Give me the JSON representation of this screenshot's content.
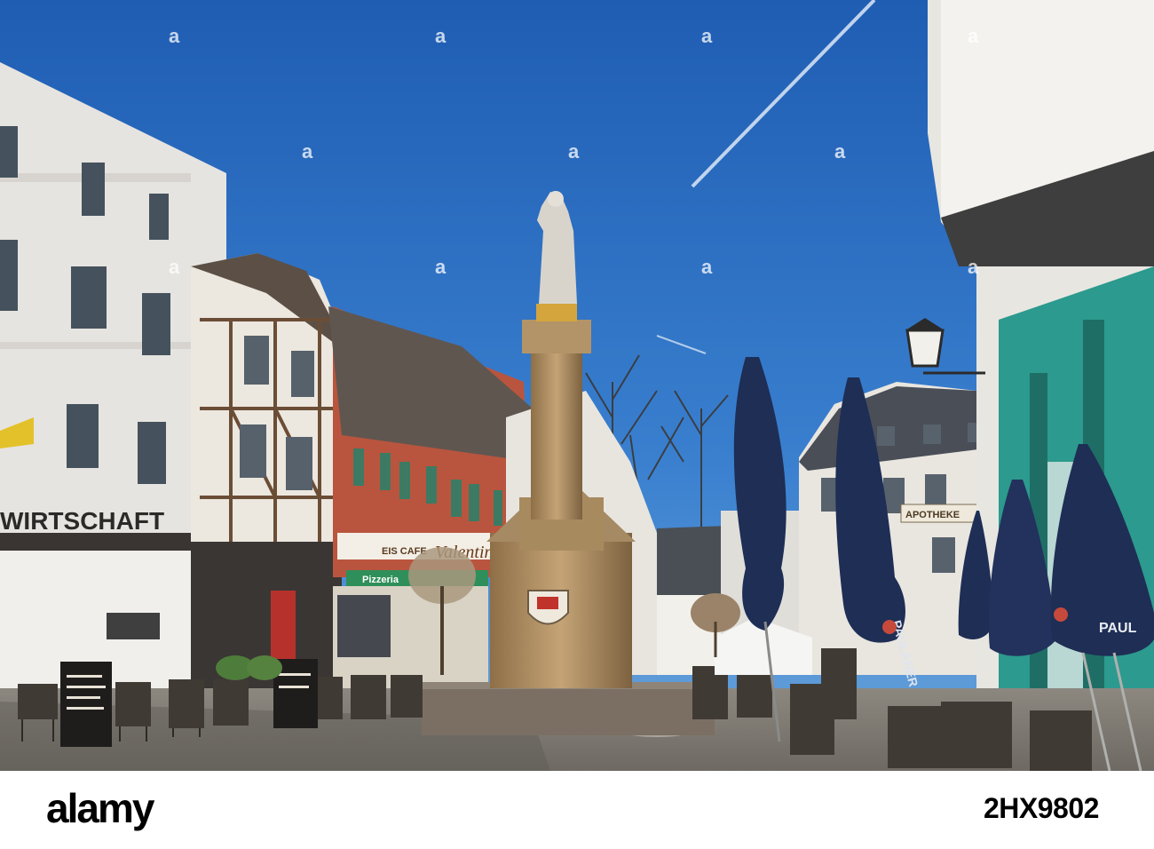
{
  "scene": {
    "signs": {
      "wirtschaft": "WIRTSCHAFT",
      "pizzeria": "Pizzeria",
      "apotheke": "APOTHEKE",
      "paulaner": "PAULANER",
      "paul": "PAUL",
      "eis_cafe": "EIS CAFE",
      "valentino": "Valentino"
    },
    "watermark_char": "a"
  },
  "banner": {
    "logo": "alamy",
    "photo_id": "2HX9802"
  },
  "colors": {
    "sky": "#2c6fc2",
    "umbrella": "#1e2e55",
    "stone_column": "#b08f63",
    "teal_facade": "#2c9a8e"
  }
}
